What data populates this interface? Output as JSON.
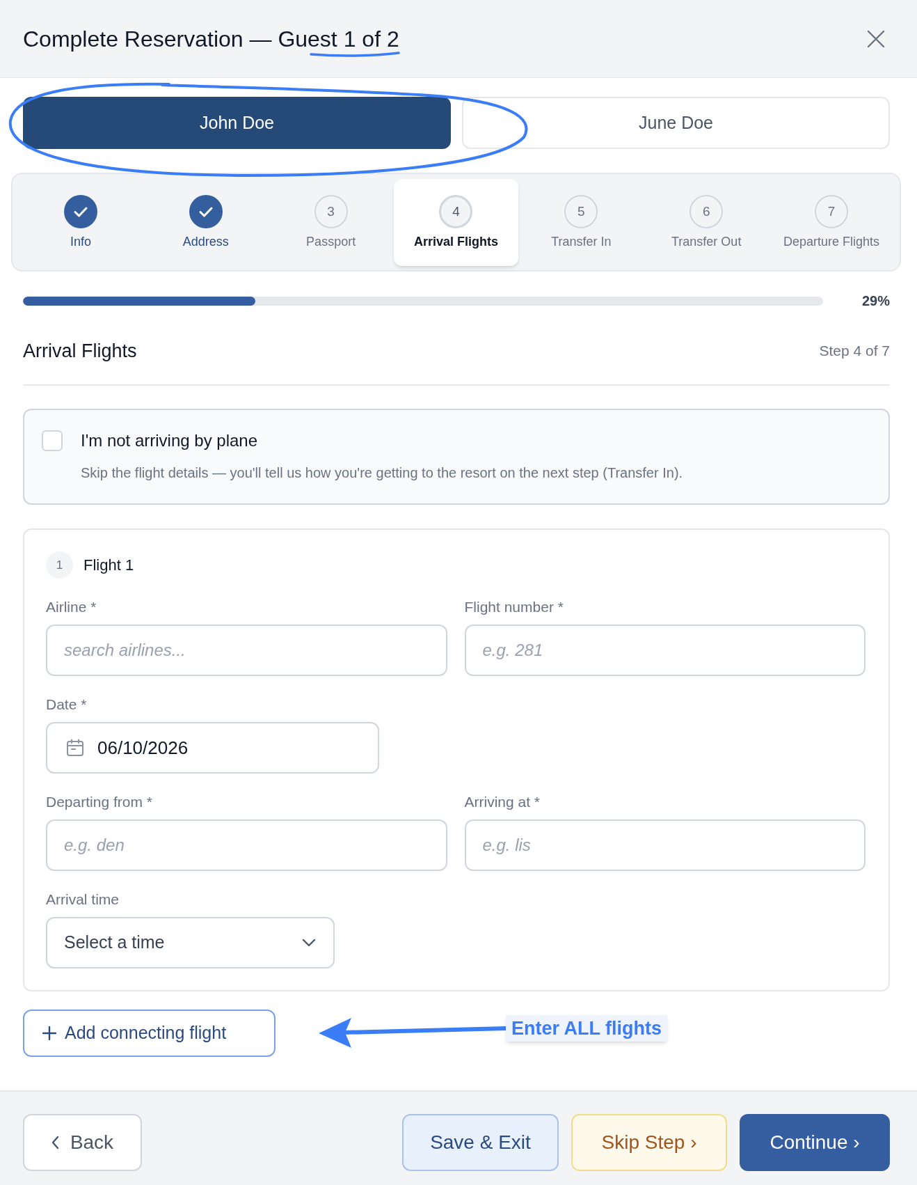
{
  "dialog": {
    "title": "Complete Reservation — Guest 1 of 2"
  },
  "guests": [
    {
      "name": "John Doe",
      "selected": true
    },
    {
      "name": "June Doe",
      "selected": false
    }
  ],
  "steps": [
    {
      "label": "Info",
      "done": true,
      "selected": false
    },
    {
      "label": "Address",
      "done": true,
      "selected": false
    },
    {
      "number": "3",
      "label": "Passport",
      "done": false,
      "selected": false
    },
    {
      "number": "4",
      "label": "Arrival Flights",
      "done": false,
      "selected": true
    },
    {
      "number": "5",
      "label": "Transfer In",
      "done": false,
      "selected": false
    },
    {
      "number": "6",
      "label": "Transfer Out",
      "done": false,
      "selected": false
    },
    {
      "number": "7",
      "label": "Departure Flights",
      "done": false,
      "selected": false
    }
  ],
  "progress": {
    "level": 0.29,
    "reading": "29%"
  },
  "section": {
    "title": "Arrival Flights",
    "step": "Step 4 of 7"
  },
  "no_plane": {
    "checked": false,
    "label": "I'm not arriving by plane",
    "description": "Skip the flight details — you'll tell us how you're getting to the resort on the next step (Transfer In)."
  },
  "flights": [
    {
      "number": "1",
      "title": "Flight 1",
      "rows": [
        {
          "fields": [
            {
              "kind": "text",
              "label": "Airline *",
              "placeholder": "search airlines..."
            },
            {
              "kind": "text",
              "label": "Flight number *",
              "placeholder": "e.g. 281"
            }
          ]
        },
        {
          "fields": [
            {
              "kind": "date",
              "label": "Date *",
              "value": "06/10/2026"
            }
          ]
        },
        {
          "fields": [
            {
              "kind": "text",
              "label": "Departing from *",
              "placeholder": "e.g. den"
            },
            {
              "kind": "text",
              "label": "Arriving at *",
              "placeholder": "e.g. lis"
            }
          ]
        },
        {
          "fields": [
            {
              "kind": "select",
              "label": "Arrival time",
              "value": "Select a time"
            }
          ]
        }
      ]
    }
  ],
  "add_flight_button": {
    "label": "Add connecting flight"
  },
  "annotations": [
    {
      "kind": "ellipse"
    },
    {
      "kind": "underline"
    },
    {
      "kind": "arrow",
      "text": "Enter ALL flights"
    }
  ],
  "footer": {
    "buttons": [
      {
        "kind": "back",
        "label": "Back"
      },
      {
        "kind": "secondary",
        "label": "Save & Exit"
      },
      {
        "kind": "warning",
        "label": "Skip Step ›"
      },
      {
        "kind": "primary",
        "label": "Continue ›"
      }
    ]
  }
}
